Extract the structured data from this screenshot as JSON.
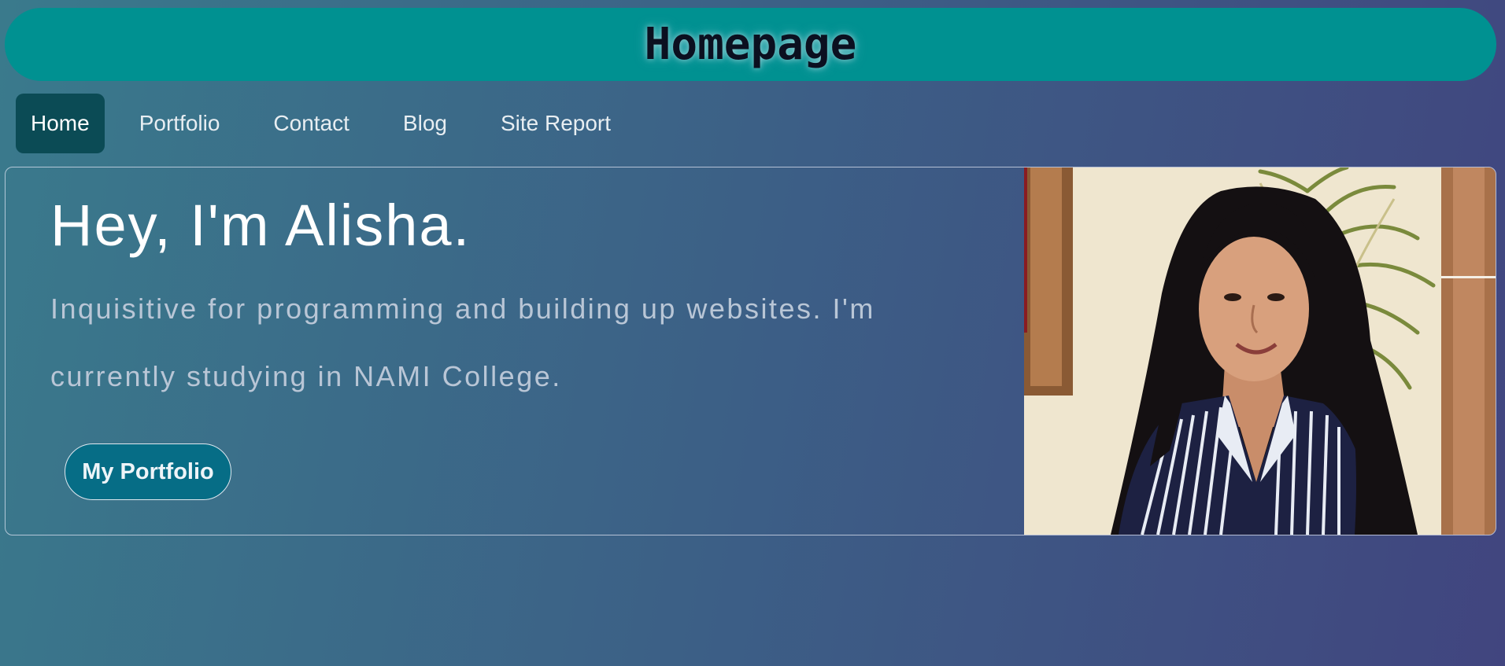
{
  "header": {
    "title": "Homepage"
  },
  "nav": {
    "items": [
      {
        "label": "Home",
        "active": true
      },
      {
        "label": "Portfolio",
        "active": false
      },
      {
        "label": "Contact",
        "active": false
      },
      {
        "label": "Blog",
        "active": false
      },
      {
        "label": "Site Report",
        "active": false
      }
    ]
  },
  "hero": {
    "heading": "Hey, I'm Alisha.",
    "description": "Inquisitive for programming and building up websites. I'm currently studying in NAMI College.",
    "button_label": "My Portfolio",
    "photo": "portrait-photo"
  },
  "colors": {
    "title_bar": "#009191",
    "nav_active": "#0b4b55",
    "button": "#066d86"
  }
}
